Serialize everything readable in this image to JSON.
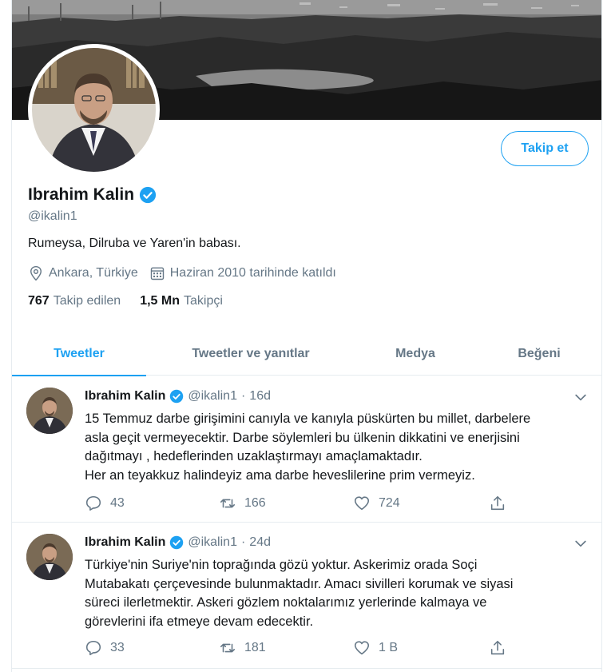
{
  "profile": {
    "follow_label": "Takip et",
    "name": "Ibrahim Kalin",
    "handle": "@ikalin1",
    "bio": "Rumeysa, Dilruba ve Yaren'in babası.",
    "location": "Ankara, Türkiye",
    "joined": "Haziran 2010 tarihinde katıldı",
    "following_count": "767",
    "following_label": "Takip edilen",
    "followers_count": "1,5 Mn",
    "followers_label": "Takipçi"
  },
  "tabs": [
    {
      "label": "Tweetler",
      "active": true
    },
    {
      "label": "Tweetler ve yanıtlar",
      "active": false
    },
    {
      "label": "Medya",
      "active": false
    },
    {
      "label": "Beğeni",
      "active": false
    }
  ],
  "tweets": [
    {
      "name": "Ibrahim Kalin",
      "handle": "@ikalin1",
      "dot": "·",
      "time": "16d",
      "lines": [
        "15 Temmuz darbe girişimini canıyla ve kanıyla püskürten bu millet, darbelere",
        "asla geçit vermeyecektir. Darbe söylemleri bu ülkenin dikkatini ve enerjisini",
        "dağıtmayı , hedeflerinden uzaklaştırmayı amaçlamaktadır.",
        "Her an teyakkuz halindeyiz ama darbe heveslilerine prim vermeyiz."
      ],
      "replies": "43",
      "retweets": "166",
      "likes": "724"
    },
    {
      "name": "Ibrahim Kalin",
      "handle": "@ikalin1",
      "dot": "·",
      "time": "24d",
      "lines": [
        "Türkiye'nin Suriye'nin toprağında gözü yoktur. Askerimiz orada Soçi",
        "Mutabakatı çerçevesinde bulunmaktadır. Amacı sivilleri korumak ve siyasi",
        "süreci ilerletmektir. Askeri gözlem noktalarımız yerlerinde kalmaya ve",
        "görevlerini ifa etmeye devam edecektir."
      ],
      "replies": "33",
      "retweets": "181",
      "likes": "1 B"
    }
  ],
  "colors": {
    "accent": "#1da1f2",
    "secondary_text": "#657786",
    "primary_text": "#14171a",
    "border": "#e6ecf0"
  },
  "icons": {
    "verified": "verified-badge-icon",
    "location": "location-pin-icon",
    "calendar": "calendar-icon",
    "reply": "reply-icon",
    "retweet": "retweet-icon",
    "like": "heart-icon",
    "share": "share-icon",
    "caret": "chevron-down-icon"
  }
}
